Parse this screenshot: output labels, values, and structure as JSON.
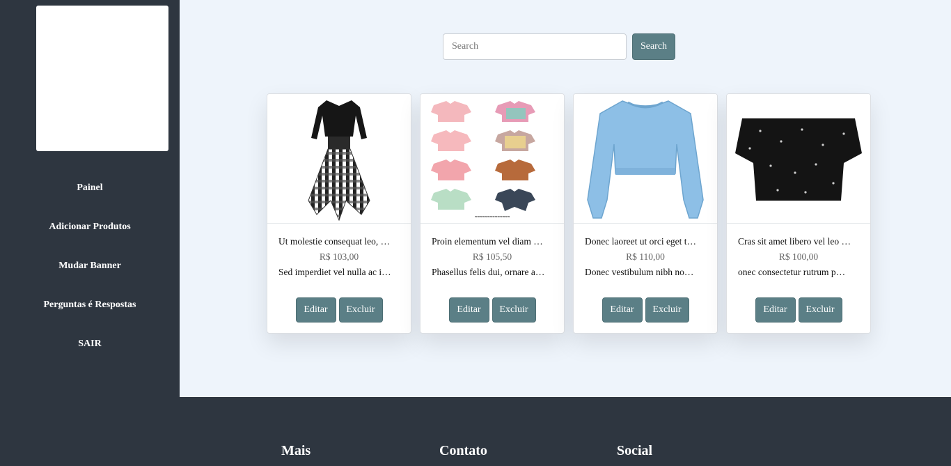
{
  "sidebar": {
    "items": [
      {
        "label": "Painel"
      },
      {
        "label": "Adicionar Produtos"
      },
      {
        "label": "Mudar Banner"
      },
      {
        "label": "Perguntas é Respostas"
      },
      {
        "label": "SAIR"
      }
    ]
  },
  "search": {
    "placeholder": "Search",
    "button_label": "Search"
  },
  "products": [
    {
      "title": "Ut molestie consequat leo, …",
      "price": "R$ 103,00",
      "description": "Sed imperdiet vel nulla ac i…",
      "image": "plaid-dress-image",
      "edit_label": "Editar",
      "delete_label": "Excluir"
    },
    {
      "title": "Proin elementum vel diam …",
      "price": "R$ 105,50",
      "description": "Phasellus felis dui, ornare a…",
      "image": "crop-tops-grid-image",
      "edit_label": "Editar",
      "delete_label": "Excluir"
    },
    {
      "title": "Donec laoreet ut orci eget t…",
      "price": "R$ 110,00",
      "description": "Donec vestibulum nibh no…",
      "image": "blue-sweatshirt-image",
      "edit_label": "Editar",
      "delete_label": "Excluir"
    },
    {
      "title": "Cras sit amet libero vel leo …",
      "price": "R$ 100,00",
      "description": "onec consectetur rutrum p…",
      "image": "star-blouse-image",
      "edit_label": "Editar",
      "delete_label": "Excluir"
    }
  ],
  "footer": {
    "col1": "Mais",
    "col2": "Contato",
    "col3": "Social"
  },
  "colors": {
    "sidebar_bg": "#2e3640",
    "main_bg": "#eef4fb",
    "button": "#5b7f86"
  }
}
